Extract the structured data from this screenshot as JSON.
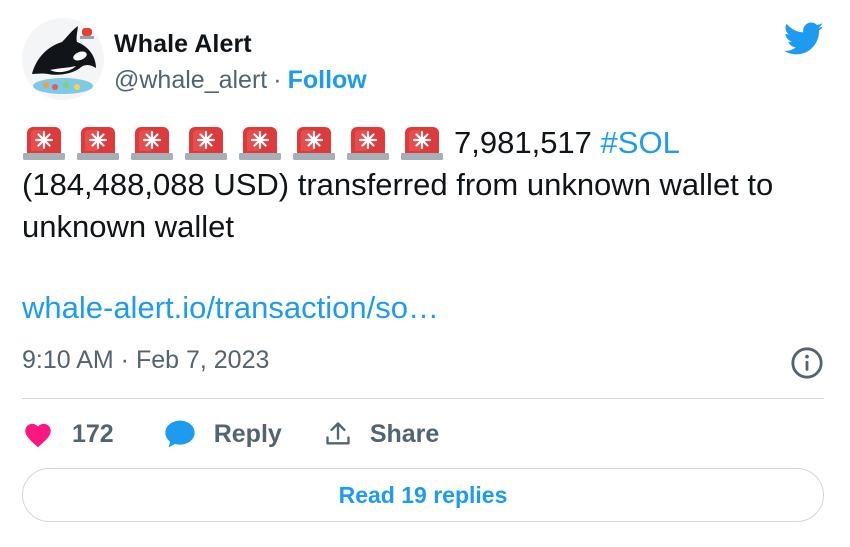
{
  "author": {
    "name": "Whale Alert",
    "handle": "@whale_alert",
    "separator": "·",
    "follow_label": "Follow"
  },
  "icons": {
    "brand": "twitter-bird-icon",
    "siren": "police-siren-icon",
    "info": "info-icon",
    "like": "heart-icon",
    "reply": "speech-bubble-icon",
    "share": "share-upload-icon"
  },
  "tweet": {
    "siren_count": 8,
    "amount": "7,981,517",
    "hashtag": "#SOL",
    "text_rest": "(184,488,088 USD) transferred from unknown wallet to unknown wallet",
    "link": "whale-alert.io/transaction/so…",
    "timestamp": "9:10 AM · Feb 7, 2023"
  },
  "actions": {
    "likes_count": "172",
    "reply_label": "Reply",
    "share_label": "Share"
  },
  "read_replies_label": "Read 19 replies",
  "colors": {
    "accent": "#1d9bf0",
    "like": "#f91880",
    "text": "#0f1419",
    "muted": "#536471",
    "border": "#cfd9de"
  }
}
